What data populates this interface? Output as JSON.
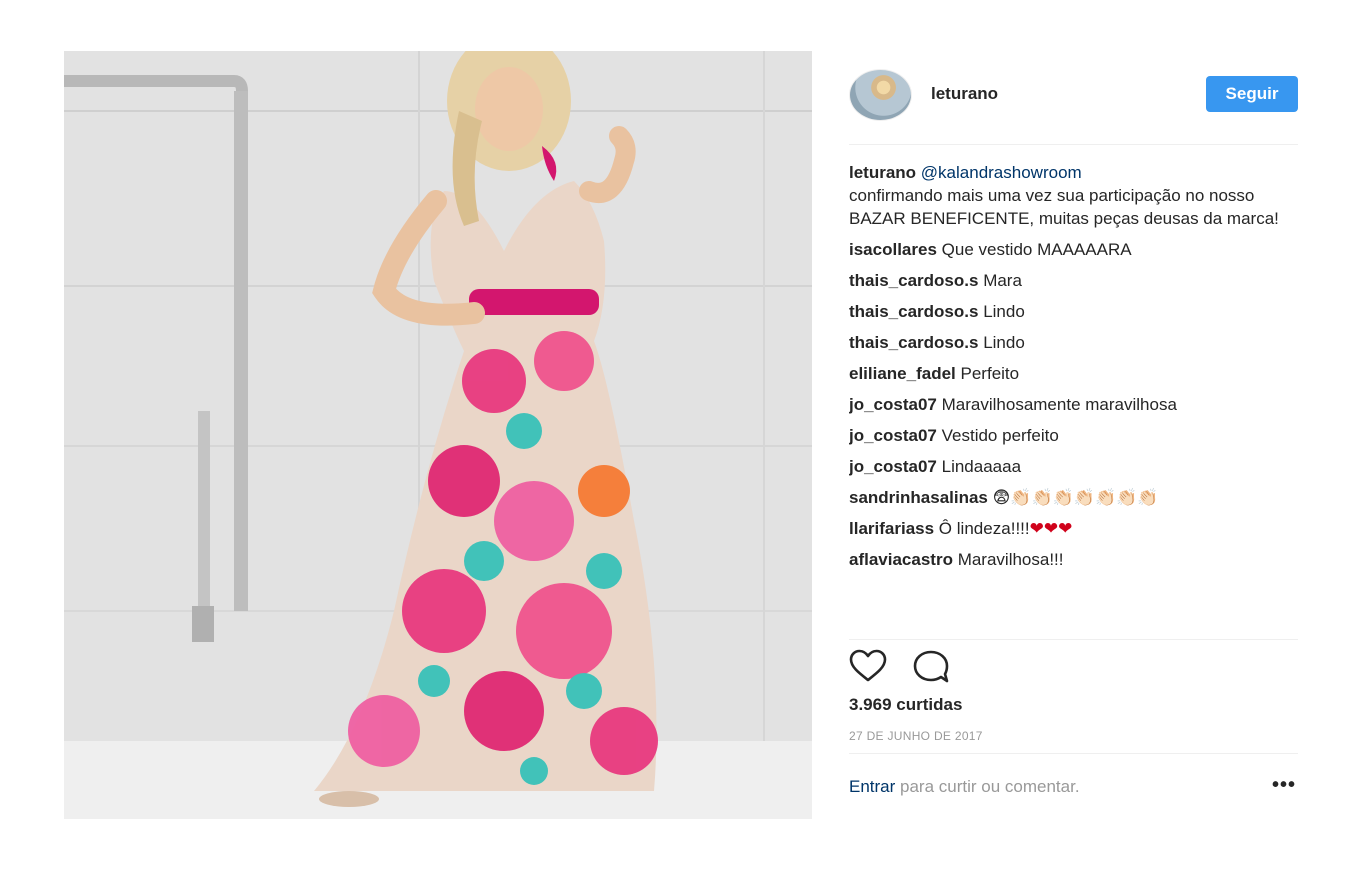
{
  "post": {
    "image_alt": "",
    "header": {
      "username": "leturano",
      "follow_label": "Seguir"
    },
    "caption": {
      "username": "leturano",
      "mention": "@kalandrashowroom",
      "text": "confirmando mais uma vez sua participação no nosso BAZAR BENEFICENTE, muitas peças deusas da marca!"
    },
    "comments": [
      {
        "user": "isacollares",
        "text": "Que vestido MAAAAARA"
      },
      {
        "user": "thais_cardoso.s",
        "text": "Mara"
      },
      {
        "user": "thais_cardoso.s",
        "text": "Lindo"
      },
      {
        "user": "thais_cardoso.s",
        "text": "Lindo"
      },
      {
        "user": "eliliane_fadel",
        "text": "Perfeito"
      },
      {
        "user": "jo_costa07",
        "text": "Maravilhosamente maravilhosa"
      },
      {
        "user": "jo_costa07",
        "text": "Vestido perfeito"
      },
      {
        "user": "jo_costa07",
        "text": "Lindaaaaa"
      },
      {
        "user": "sandrinhasalinas",
        "text": "😨👏🏻👏🏻👏🏻👏🏻👏🏻👏🏻👏🏻"
      },
      {
        "user": "llarifariass",
        "text": "Ô lindeza!!!!❤❤❤"
      },
      {
        "user": "aflaviacastro",
        "text": "Maravilhosa!!!"
      }
    ],
    "likes_text": "3.969 curtidas",
    "date_text": "27 DE JUNHO DE 2017",
    "footer": {
      "login_link": "Entrar",
      "login_rest": " para curtir ou comentar.",
      "more_label": "•••"
    },
    "icons": {
      "like": "heart-outline-icon",
      "comment": "comment-bubble-icon",
      "more": "ellipsis-icon"
    },
    "colors": {
      "follow_button": "#3897f0",
      "link": "#003569",
      "muted": "#999999",
      "text": "#262626"
    }
  }
}
